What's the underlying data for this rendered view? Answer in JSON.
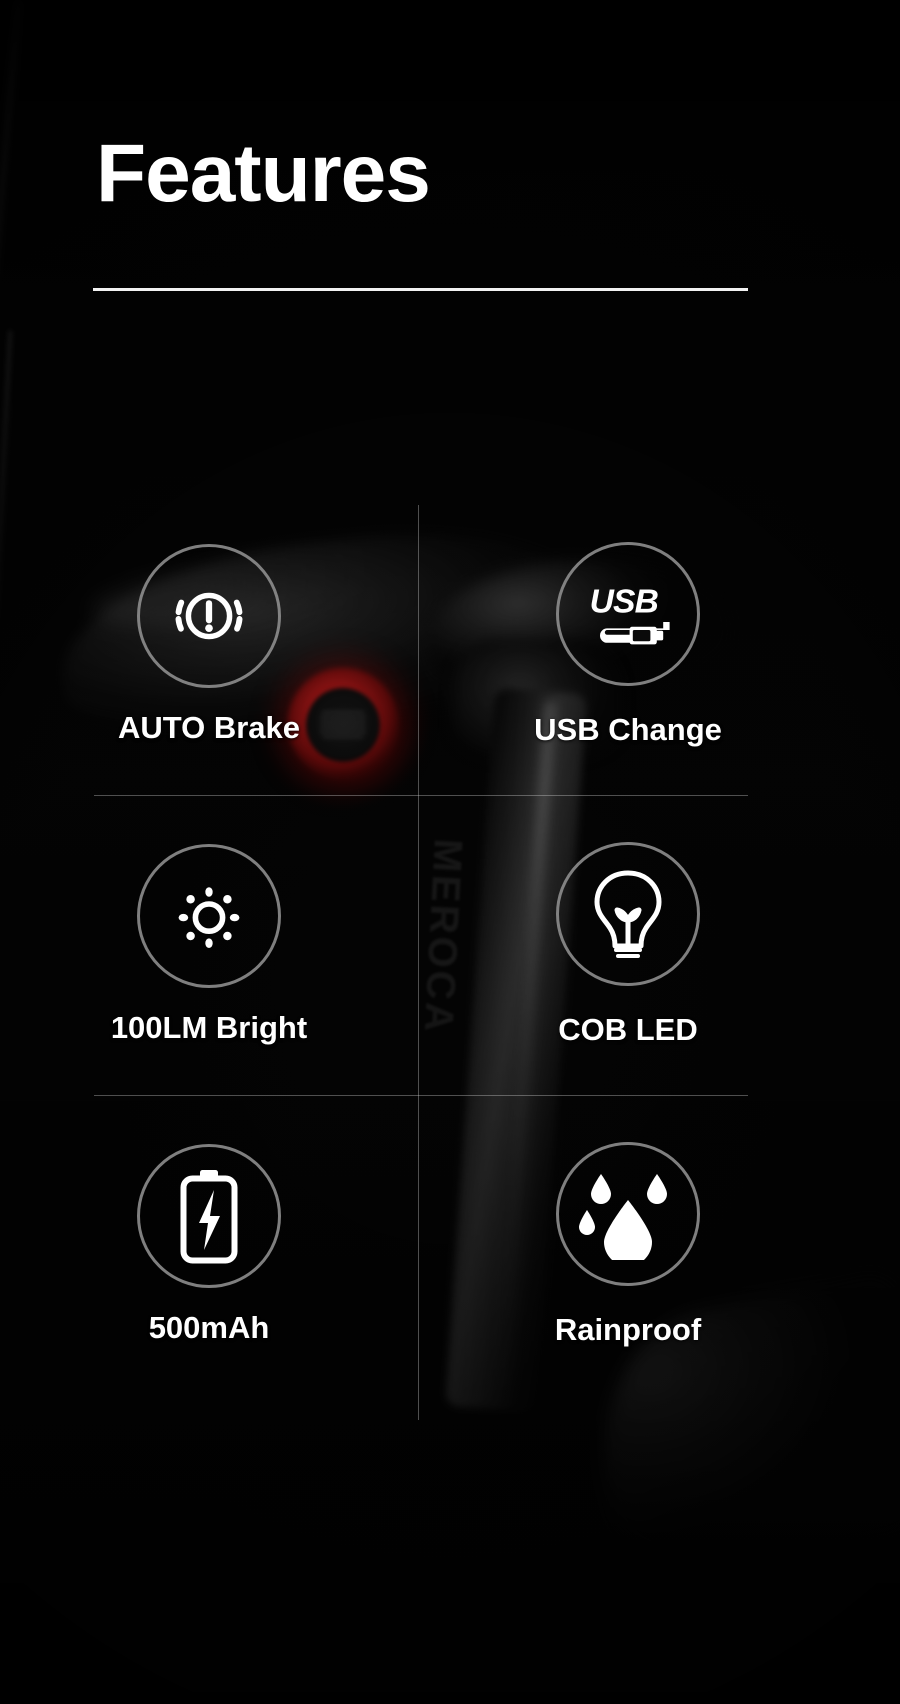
{
  "page": {
    "title": "Features",
    "background_color": "#050505",
    "text_color": "#ffffff",
    "accent_rule_color": "#f2f2f2",
    "ring_color": "#919191",
    "divider_color": "#d7d7d7",
    "lamp_color": "#c21a1a"
  },
  "features": [
    {
      "id": "auto-brake",
      "label": "AUTO Brake",
      "icon": "brake-warning-icon"
    },
    {
      "id": "usb-change",
      "label": "USB Change",
      "icon": "usb-cable-icon",
      "icon_text": "USB"
    },
    {
      "id": "brightness",
      "label": "100LM Bright",
      "icon": "brightness-sun-icon"
    },
    {
      "id": "cob-led",
      "label": "COB LED",
      "icon": "light-bulb-icon"
    },
    {
      "id": "battery",
      "label": "500mAh",
      "icon": "battery-charging-icon"
    },
    {
      "id": "rainproof",
      "label": "Rainproof",
      "icon": "water-drops-icon"
    }
  ]
}
